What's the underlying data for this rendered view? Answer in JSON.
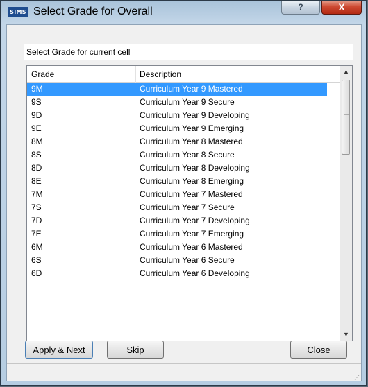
{
  "window": {
    "app_icon_text": "SIMS",
    "title": "Select Grade for Overall",
    "help_label": "?",
    "close_label": "X"
  },
  "dialog": {
    "subtitle": "Select Grade for current cell"
  },
  "list": {
    "columns": [
      "Grade",
      "Description"
    ],
    "selected_index": 0,
    "rows": [
      {
        "grade": "9M",
        "description": "Curriculum Year 9 Mastered"
      },
      {
        "grade": "9S",
        "description": "Curriculum Year 9 Secure"
      },
      {
        "grade": "9D",
        "description": "Curriculum Year 9 Developing"
      },
      {
        "grade": "9E",
        "description": "Curriculum Year 9 Emerging"
      },
      {
        "grade": "8M",
        "description": "Curriculum Year 8 Mastered"
      },
      {
        "grade": "8S",
        "description": "Curriculum Year 8 Secure"
      },
      {
        "grade": "8D",
        "description": "Curriculum Year 8 Developing"
      },
      {
        "grade": "8E",
        "description": "Curriculum Year 8 Emerging"
      },
      {
        "grade": "7M",
        "description": "Curriculum Year 7 Mastered"
      },
      {
        "grade": "7S",
        "description": "Curriculum Year 7 Secure"
      },
      {
        "grade": "7D",
        "description": "Curriculum Year 7 Developing"
      },
      {
        "grade": "7E",
        "description": "Curriculum Year 7 Emerging"
      },
      {
        "grade": "6M",
        "description": "Curriculum Year 6 Mastered"
      },
      {
        "grade": "6S",
        "description": "Curriculum Year 6 Secure"
      },
      {
        "grade": "6D",
        "description": "Curriculum Year 6 Developing"
      }
    ],
    "scroll_up_icon": "scroll-up-arrow",
    "scroll_down_icon": "scroll-down-arrow"
  },
  "buttons": {
    "apply_next": "Apply & Next",
    "skip": "Skip",
    "close": "Close"
  },
  "colors": {
    "selection": "#3399ff",
    "title_close": "#c8452f"
  }
}
